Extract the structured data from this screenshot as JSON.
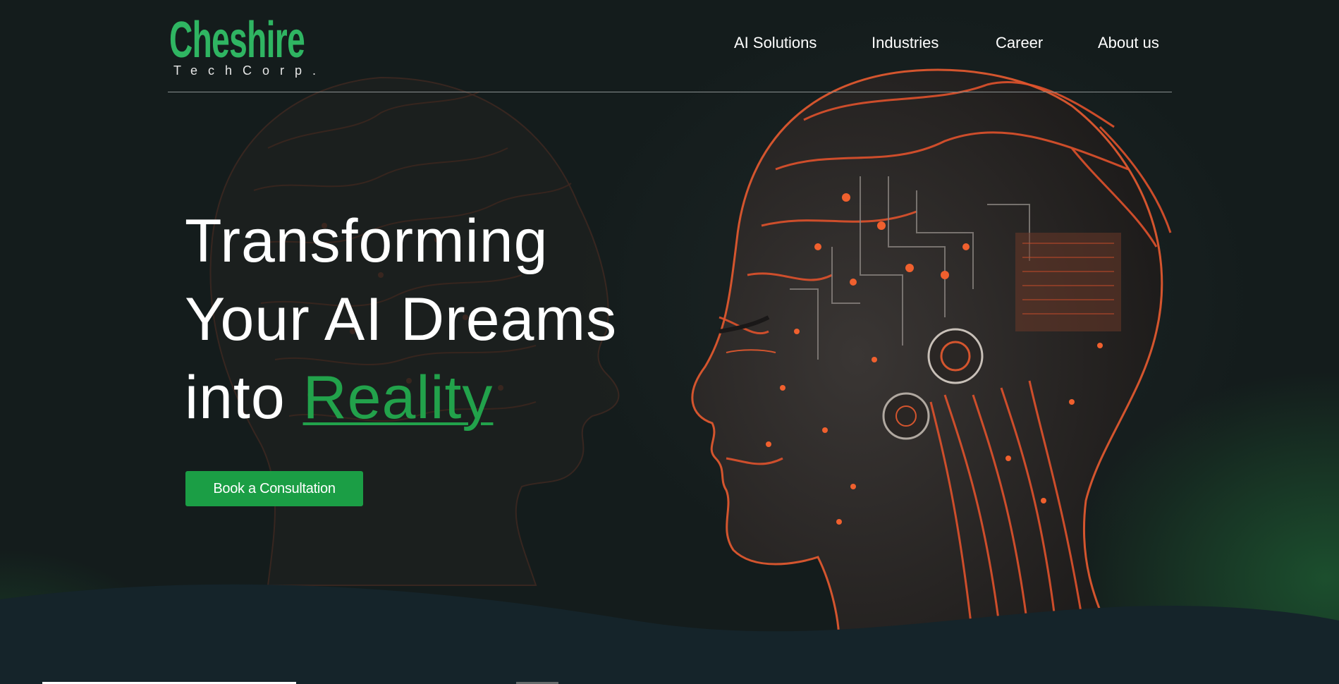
{
  "brand": {
    "name": "Cheshire",
    "tagline": "TechCorp.",
    "accent_color": "#2fb562"
  },
  "nav": {
    "items": [
      {
        "label": "AI Solutions"
      },
      {
        "label": "Industries"
      },
      {
        "label": "Career"
      },
      {
        "label": "About us"
      }
    ]
  },
  "hero": {
    "headline_line1": "Transforming",
    "headline_line2": "Your AI Dreams",
    "headline_line3_prefix": "into ",
    "headline_accent_word": "Reality",
    "cta_label": "Book a Consultation",
    "cta_color": "#1b9e45",
    "image": "circuit-head-profile-image"
  },
  "colors": {
    "background": "#141c1c",
    "text": "#ffffff",
    "circuit_orange": "#e0522c"
  }
}
